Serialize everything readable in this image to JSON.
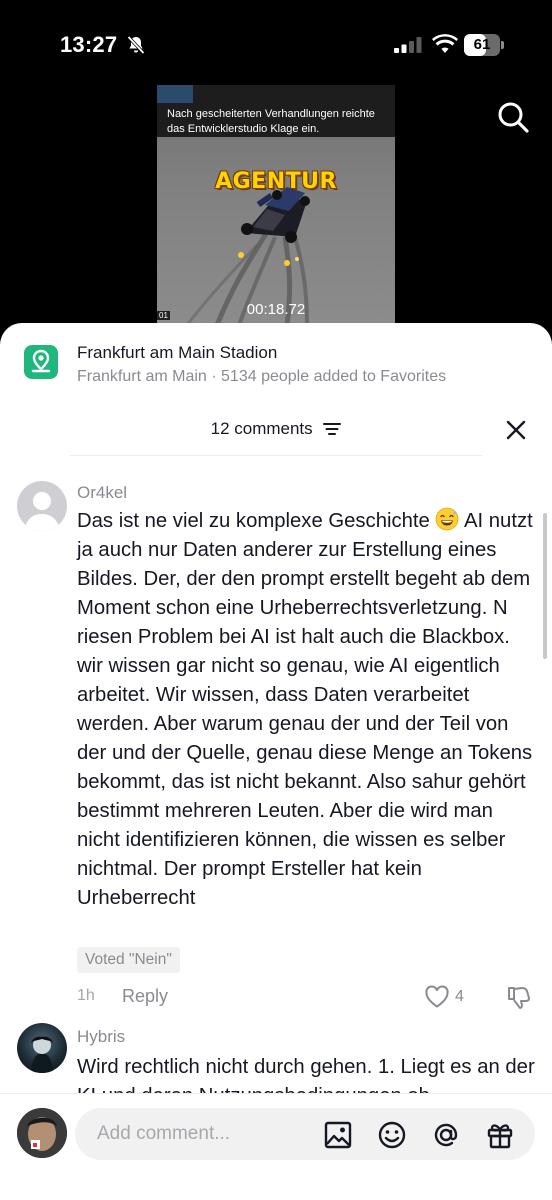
{
  "status_bar": {
    "time": "13:27",
    "battery": "61",
    "battery_level": 0.61
  },
  "video": {
    "caption": "Nach gescheiterten Verhandlungen reichte das Entwicklerstudio Klage ein.",
    "overlay_title": "AGENTUR",
    "timer": "00:18.72",
    "corner_label": "01"
  },
  "place": {
    "name": "Frankfurt am Main Stadion",
    "subtitle": "Frankfurt am Main · 5134 people added to Favorites"
  },
  "comments_header": {
    "title": "12 comments"
  },
  "comments": [
    {
      "user": "Or4kel",
      "text_before_emoji": "Das ist ne viel zu komplexe Geschichte ",
      "text_after_emoji": " AI nutzt ja auch nur Daten anderer zur Erstellung eines Bildes. Der, der den prompt erstellt begeht ab dem Moment schon eine Urheberrechtsverletzung. N riesen Problem bei AI ist halt auch die Blackbox. wir wissen gar nicht so genau, wie AI eigentlich arbeitet. Wir wissen, dass Daten verarbeitet werden. Aber warum genau der und der Teil von der und der Quelle, genau diese Menge an Tokens bekommt, das ist nicht bekannt. Also sahur gehört bestimmt mehreren Leuten. Aber die wird man nicht identifizieren können, die wissen es selber nichtmal. Der prompt Ersteller hat kein Urheberrecht",
      "voted": "Voted \"Nein\"",
      "time": "1h",
      "reply": "Reply",
      "likes": "4"
    },
    {
      "user": "Hybris",
      "text": "Wird rechtlich nicht durch gehen. 1. Liegt es an der KI und deren Nutzungsbedingungen ob"
    }
  ],
  "input": {
    "placeholder": "Add comment..."
  },
  "icons": {
    "search": "search-icon",
    "close": "close-icon",
    "sort": "sort-icon",
    "place": "location-pin-icon",
    "heart": "heart-icon",
    "dislike": "thumbs-down-icon",
    "image": "image-icon",
    "emoji": "emoji-icon",
    "mention": "at-icon",
    "gift": "gift-icon"
  }
}
